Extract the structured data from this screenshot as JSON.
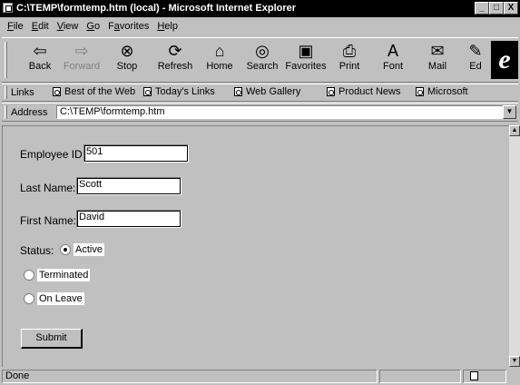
{
  "window": {
    "title": "C:\\TEMP\\formtemp.htm (local) - Microsoft Internet Explorer",
    "minimize": "_",
    "maximize": "□",
    "close": "X"
  },
  "menu": [
    "File",
    "Edit",
    "View",
    "Go",
    "Favorites",
    "Help"
  ],
  "menu_underline": [
    "F",
    "E",
    "V",
    "G",
    "a",
    "H"
  ],
  "toolbar": [
    {
      "label": "Back",
      "icon": "⇦",
      "icon_name": "back-arrow-icon"
    },
    {
      "label": "Forward",
      "icon": "⇨",
      "icon_name": "forward-arrow-icon"
    },
    {
      "label": "Stop",
      "icon": "⊗",
      "icon_name": "stop-icon"
    },
    {
      "label": "Refresh",
      "icon": "⟳",
      "icon_name": "refresh-icon"
    },
    {
      "label": "Home",
      "icon": "⌂",
      "icon_name": "home-icon"
    },
    {
      "label": "Search",
      "icon": "◎",
      "icon_name": "search-icon"
    },
    {
      "label": "Favorites",
      "icon": "▣",
      "icon_name": "favorites-icon"
    },
    {
      "label": "Print",
      "icon": "⎙",
      "icon_name": "print-icon"
    },
    {
      "label": "Font",
      "icon": "A",
      "icon_name": "font-icon"
    },
    {
      "label": "Mail",
      "icon": "✉",
      "icon_name": "mail-icon"
    },
    {
      "label": "Ed",
      "icon": "✎",
      "icon_name": "edit-icon"
    }
  ],
  "links": {
    "label": "Links",
    "items": [
      "Best of the Web",
      "Today's Links",
      "Web Gallery",
      "Product News",
      "Microsoft"
    ]
  },
  "address": {
    "label": "Address",
    "value": "C:\\TEMP\\formtemp.htm"
  },
  "form": {
    "employee_id_label": "Employee ID:",
    "employee_id_value": "501",
    "last_name_label": "Last Name:",
    "last_name_value": "Scott",
    "first_name_label": "First Name:",
    "first_name_value": "David",
    "status_label": "Status:",
    "status_options": [
      "Active",
      "Terminated",
      "On Leave"
    ],
    "status_selected": "Active",
    "submit_label": "Submit"
  },
  "statusbar": {
    "text": "Done"
  }
}
